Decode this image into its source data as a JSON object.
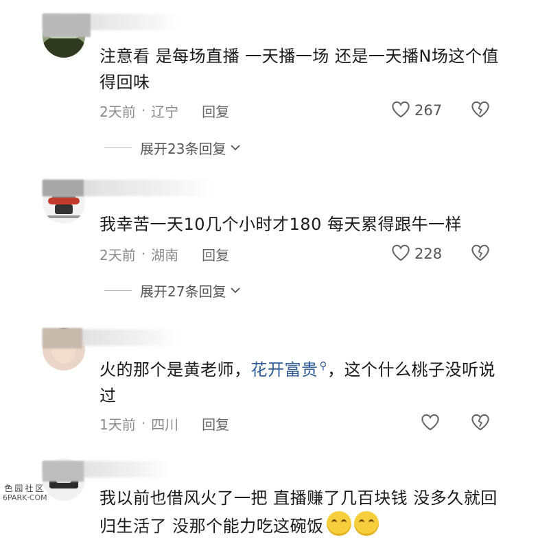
{
  "comments": [
    {
      "text": "注意看 是每场直播 一天播一场 还是一天播N场这个值得回味",
      "time": "2天前",
      "location": "辽宁",
      "reply_label": "回复",
      "likes": "267",
      "expand_label": "展开23条回复"
    },
    {
      "text": "我幸苦一天10几个小时才180 每天累得跟牛一样",
      "time": "2天前",
      "location": "湖南",
      "reply_label": "回复",
      "likes": "228",
      "expand_label": "展开27条回复"
    },
    {
      "text_before": "火的那个是黄老师，",
      "link_text": "花开富贵",
      "text_after": "，这个什么桃子没听说过",
      "time": "1天前",
      "location": "四川",
      "reply_label": "回复"
    },
    {
      "text": "我以前也借风火了一把 直播赚了几百块钱 没多久就回归生活了 没那个能力吃这碗饭"
    }
  ],
  "icons": {
    "like": "heart-outline-icon",
    "dislike": "broken-heart-icon",
    "expand": "chevron-down-icon",
    "search": "search-icon"
  },
  "watermark": {
    "cn": "色园社区",
    "en": "6PARK·COM"
  },
  "colors": {
    "text": "#1a1a1a",
    "meta": "#8a8a8a",
    "link": "#2f5d9a"
  }
}
